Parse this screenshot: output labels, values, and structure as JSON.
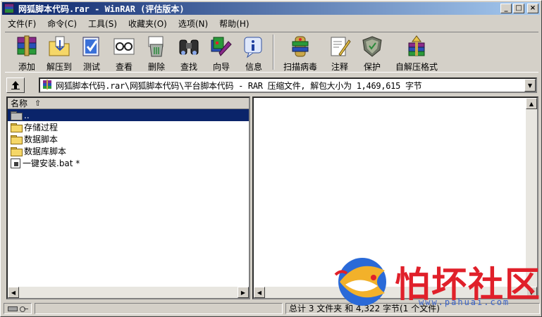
{
  "window": {
    "title": "网狐脚本代码.rar - WinRAR (评估版本)",
    "buttons": {
      "minimize": "_",
      "maximize": "□",
      "close": "×"
    }
  },
  "menu": [
    {
      "id": "file",
      "label": "文件(F)"
    },
    {
      "id": "commands",
      "label": "命令(C)"
    },
    {
      "id": "tools",
      "label": "工具(S)"
    },
    {
      "id": "favorites",
      "label": "收藏夹(O)"
    },
    {
      "id": "options",
      "label": "选项(N)"
    },
    {
      "id": "help",
      "label": "帮助(H)"
    }
  ],
  "toolbar": {
    "add": "添加",
    "extract": "解压到",
    "test": "测试",
    "view": "查看",
    "delete": "删除",
    "find": "查找",
    "wizard": "向导",
    "info": "信息",
    "virusscan": "扫描病毒",
    "comment": "注释",
    "protect": "保护",
    "sfx": "自解压格式"
  },
  "address": {
    "path": "网狐脚本代码.rar\\网狐脚本代码\\平台脚本代码 - RAR 压缩文件, 解包大小为 1,469,615 字节"
  },
  "file_list": {
    "column_name": "名称",
    "sort_indicator": "⇧",
    "rows": [
      {
        "name": "..",
        "type": "parent"
      },
      {
        "name": "存储过程",
        "type": "folder"
      },
      {
        "name": "数据脚本",
        "type": "folder"
      },
      {
        "name": "数据库脚本",
        "type": "folder"
      },
      {
        "name": "一键安装.bat *",
        "type": "bat"
      }
    ]
  },
  "status": {
    "summary": "总计 3 文件夹 和 4,322 字节(1 个文件)"
  },
  "watermark": {
    "brand": "怕坏社区",
    "url": "www.pahuai.com"
  },
  "colors": {
    "titlebar_start": "#0a246a",
    "titlebar_end": "#a6caf0",
    "selection": "#0a246a",
    "face": "#d4d0c8",
    "watermark_red": "#e0202a",
    "watermark_blue": "#3a63c8"
  }
}
